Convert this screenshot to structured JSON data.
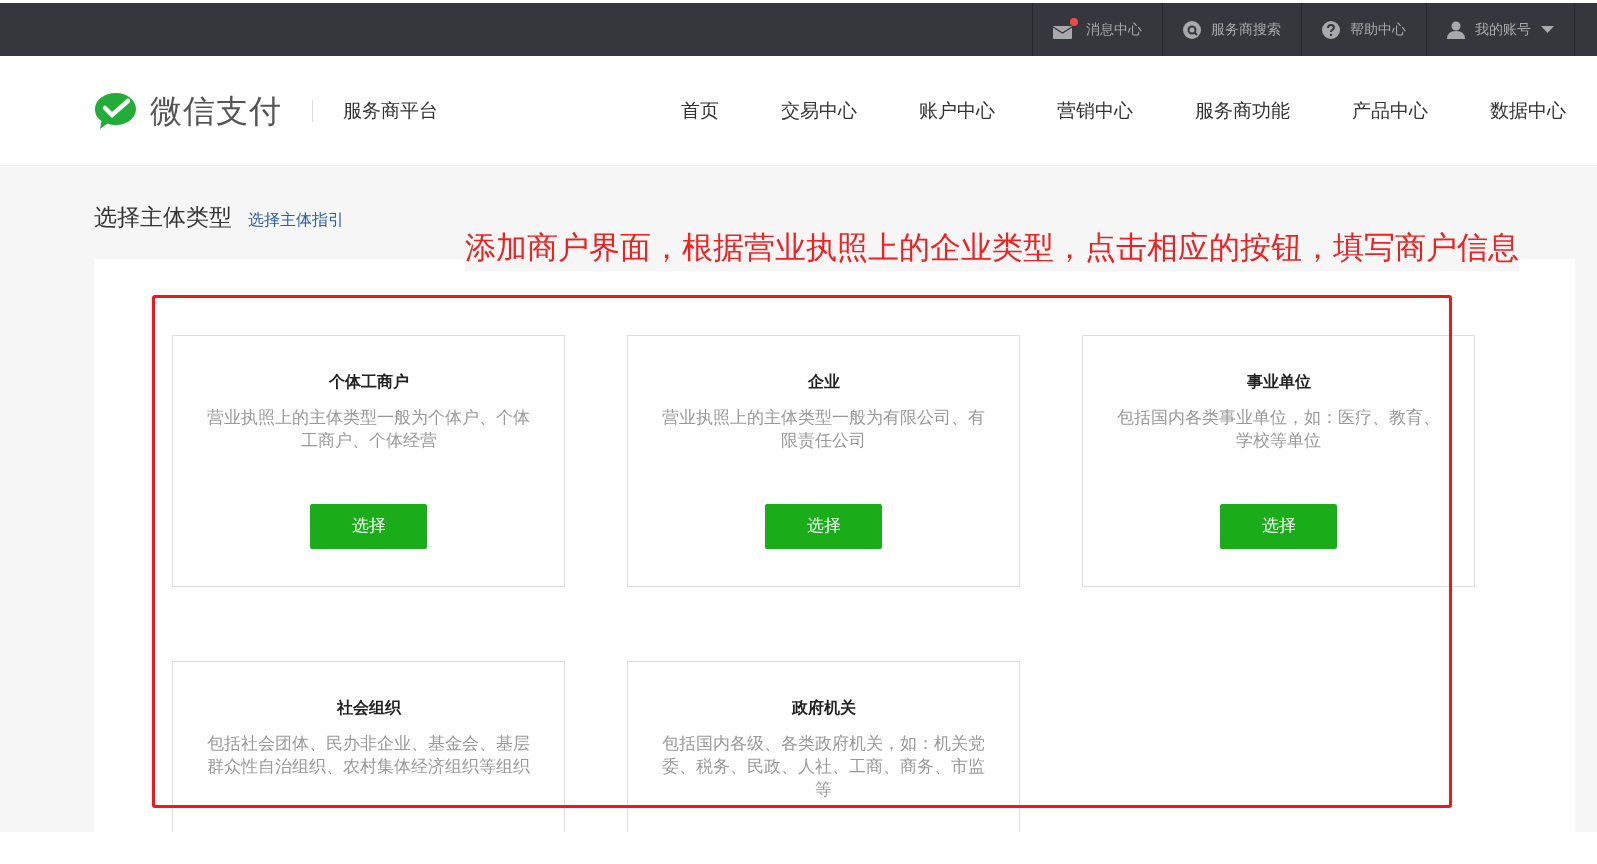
{
  "top_bar": {
    "items": [
      {
        "kind": "mail",
        "label": "消息中心",
        "unread": true
      },
      {
        "kind": "search",
        "label": "服务商搜索",
        "unread": false
      },
      {
        "kind": "help",
        "label": "帮助中心",
        "unread": false
      },
      {
        "kind": "user",
        "label": "我的账号",
        "unread": false
      }
    ]
  },
  "header": {
    "logo_text": "微信支付",
    "platform": "服务商平台",
    "nav": [
      "首页",
      "交易中心",
      "账户中心",
      "营销中心",
      "服务商功能",
      "产品中心",
      "数据中心"
    ]
  },
  "page": {
    "title": "选择主体类型",
    "guide_link": "选择主体指引"
  },
  "annotation": {
    "text": "添加商户界面，根据营业执照上的企业类型，点击相应的按钮，填写商户信息"
  },
  "cards": [
    {
      "title": "个体工商户",
      "description": "营业执照上的主体类型一般为个体户、个体工商户、个体经营",
      "button": "选择"
    },
    {
      "title": "企业",
      "description": "营业执照上的主体类型一般为有限公司、有限责任公司",
      "button": "选择"
    },
    {
      "title": "事业单位",
      "description": "包括国内各类事业单位，如：医疗、教育、学校等单位",
      "button": "选择"
    },
    {
      "title": "社会组织",
      "description": "包括社会团体、民办非企业、基金会、基层群众性自治组织、农村集体经济组织等组织"
    },
    {
      "title": "政府机关",
      "description": "包括国内各级、各类政府机关，如：机关党委、税务、民政、人社、工商、商务、市监等"
    }
  ]
}
